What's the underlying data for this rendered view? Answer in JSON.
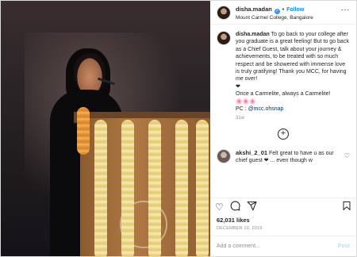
{
  "header": {
    "username": "disha.madan",
    "separator": "•",
    "follow_label": "Follow",
    "location": "Mount Carmel College, Bangalore",
    "more_icon": "ellipsis-icon"
  },
  "caption": {
    "username": "disha.madan",
    "lines": [
      "To go back to your college after you graduate is a great feeling! But to go back as a Chief Guest, talk about your journey & achievements, to be treated with so much respect and be showered with immense love is truly gratifying! Thank you MCC, for having me over!",
      "❤",
      "Once a Carmelite, always a Carmelite!",
      "🌸🌸🌸"
    ],
    "pc_prefix": "PC : ",
    "pc_handle": "@mcc.ohsnap",
    "time": "31w"
  },
  "comments": [
    {
      "username": "akshi_2_01",
      "text": "Felt great to have u as our chief guest ❤ ... even though w"
    }
  ],
  "actions": {
    "like_icon": "heart-icon",
    "comment_icon": "comment-icon",
    "share_icon": "share-icon",
    "save_icon": "bookmark-icon"
  },
  "likes": "62,031 likes",
  "date": "DECEMBER 19, 2019",
  "add_comment": {
    "placeholder": "Add a comment...",
    "post_label": "Post"
  },
  "colors": {
    "accent": "#0095f6",
    "verified": "#3897f0",
    "text": "#262626",
    "muted": "#8e8e8e"
  }
}
